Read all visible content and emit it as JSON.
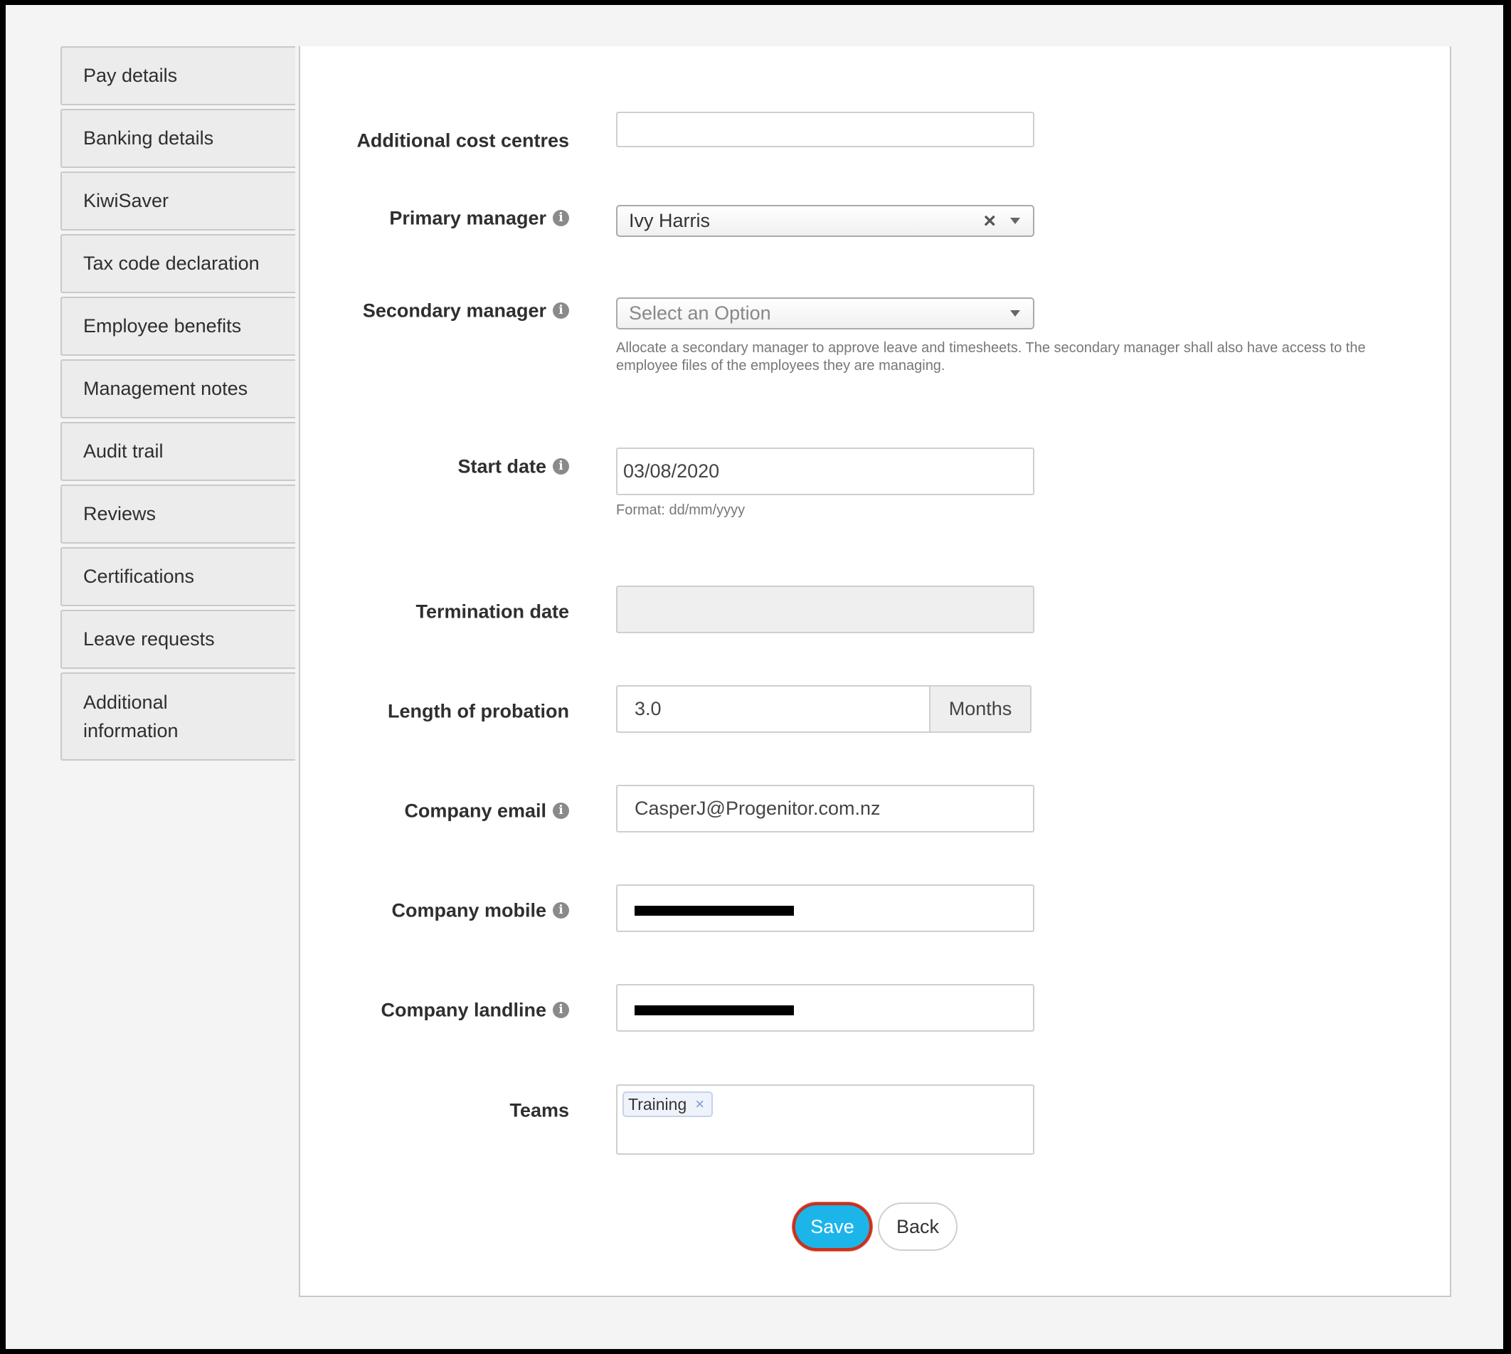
{
  "sidebar": {
    "items": [
      {
        "label": "Pay details"
      },
      {
        "label": "Banking details"
      },
      {
        "label": "KiwiSaver"
      },
      {
        "label": "Tax code declaration"
      },
      {
        "label": "Employee benefits"
      },
      {
        "label": "Management notes"
      },
      {
        "label": "Audit trail"
      },
      {
        "label": "Reviews"
      },
      {
        "label": "Certifications"
      },
      {
        "label": "Leave requests"
      },
      {
        "label": "Additional information"
      }
    ]
  },
  "form": {
    "additional_cost_centres": {
      "label": "Additional cost centres",
      "value": ""
    },
    "primary_manager": {
      "label": "Primary manager",
      "value": "Ivy Harris"
    },
    "secondary_manager": {
      "label": "Secondary manager",
      "placeholder": "Select an Option",
      "help": "Allocate a secondary manager to approve leave and timesheets. The secondary manager shall also have access to the employee files of the employees they are managing."
    },
    "start_date": {
      "label": "Start date",
      "value": "03/08/2020",
      "help": "Format: dd/mm/yyyy"
    },
    "termination_date": {
      "label": "Termination date",
      "value": ""
    },
    "length_of_probation": {
      "label": "Length of probation",
      "value": "3.0",
      "unit": "Months"
    },
    "company_email": {
      "label": "Company email",
      "value": "CasperJ@Progenitor.com.nz"
    },
    "company_mobile": {
      "label": "Company mobile"
    },
    "company_landline": {
      "label": "Company landline"
    },
    "teams": {
      "label": "Teams",
      "tags": [
        "Training"
      ]
    }
  },
  "actions": {
    "save_label": "Save",
    "back_label": "Back"
  },
  "icons": {
    "info": "info-icon",
    "clear": "clear-icon",
    "dropdown": "chevron-down-icon",
    "tag_remove": "tag-remove-icon"
  },
  "colors": {
    "save_button": "#1cb5e9",
    "save_outline": "#c8311f"
  }
}
